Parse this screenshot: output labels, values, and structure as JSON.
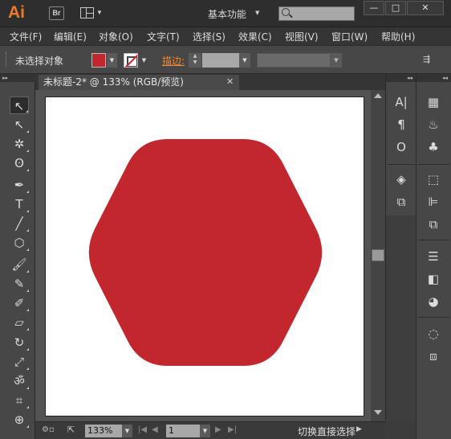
{
  "app": {
    "logo": "Ai",
    "bridge_label": "Br",
    "workspace": "基本功能",
    "search_placeholder": ""
  },
  "window_controls": {
    "minimize": "—",
    "maximize": "□",
    "close": "✕"
  },
  "menu": [
    {
      "label": "文件(F)"
    },
    {
      "label": "编辑(E)"
    },
    {
      "label": "对象(O)"
    },
    {
      "label": "文字(T)"
    },
    {
      "label": "选择(S)"
    },
    {
      "label": "效果(C)"
    },
    {
      "label": "视图(V)"
    },
    {
      "label": "窗口(W)"
    },
    {
      "label": "帮助(H)"
    }
  ],
  "control_bar": {
    "selection_status": "未选择对象",
    "stroke_label": "描边:",
    "fill_color": "#c1272d"
  },
  "document": {
    "tab_title": "未标题-2* @ 133% (RGB/预览)",
    "close": "✕",
    "shape": "rounded-hexagon",
    "shape_color": "#c1272d"
  },
  "status_bar": {
    "zoom": "133%",
    "page": "1",
    "status_text": "切换直接选择"
  },
  "tools": [
    {
      "icon": "selection-tool-icon",
      "glyph": "↖"
    },
    {
      "icon": "direct-selection-tool-icon",
      "glyph": "↖"
    },
    {
      "icon": "magic-wand-tool-icon",
      "glyph": "✲"
    },
    {
      "icon": "lasso-tool-icon",
      "glyph": "ʘ"
    },
    {
      "icon": "pen-tool-icon",
      "glyph": "✒"
    },
    {
      "icon": "type-tool-icon",
      "glyph": "T"
    },
    {
      "icon": "line-tool-icon",
      "glyph": "╱"
    },
    {
      "icon": "polygon-tool-icon",
      "glyph": "⬡"
    },
    {
      "icon": "paintbrush-tool-icon",
      "glyph": "🖌"
    },
    {
      "icon": "pencil-tool-icon",
      "glyph": "✎"
    },
    {
      "icon": "blob-brush-tool-icon",
      "glyph": "✐"
    },
    {
      "icon": "eraser-tool-icon",
      "glyph": "▱"
    },
    {
      "icon": "rotate-tool-icon",
      "glyph": "↻"
    },
    {
      "icon": "scale-tool-icon",
      "glyph": "⤢"
    },
    {
      "icon": "warp-tool-icon",
      "glyph": "ॐ"
    },
    {
      "icon": "free-transform-tool-icon",
      "glyph": "⌗"
    },
    {
      "icon": "shape-builder-tool-icon",
      "glyph": "⊕"
    }
  ],
  "right_panel_1": [
    {
      "icon": "character-panel-icon",
      "glyph": "A|"
    },
    {
      "icon": "paragraph-panel-icon",
      "glyph": "¶"
    },
    {
      "icon": "opentype-panel-icon",
      "glyph": "O"
    },
    {
      "icon": "layers-panel-icon",
      "glyph": "◈"
    },
    {
      "icon": "artboards-panel-icon",
      "glyph": "⧉"
    }
  ],
  "right_panel_2": [
    {
      "icon": "swatches-panel-icon",
      "glyph": "▦"
    },
    {
      "icon": "brushes-panel-icon",
      "glyph": "♨"
    },
    {
      "icon": "symbols-panel-icon",
      "glyph": "♣"
    },
    {
      "icon": "transform-panel-icon",
      "glyph": "⬚"
    },
    {
      "icon": "align-panel-icon",
      "glyph": "⊫"
    },
    {
      "icon": "pathfinder-panel-icon",
      "glyph": "⧉"
    },
    {
      "icon": "stroke-panel-icon",
      "glyph": "☰"
    },
    {
      "icon": "gradient-panel-icon",
      "glyph": "◧"
    },
    {
      "icon": "appearance-panel-icon",
      "glyph": "◕"
    },
    {
      "icon": "graphic-styles-panel-icon",
      "glyph": "◌"
    },
    {
      "icon": "image-trace-panel-icon",
      "glyph": "⧈"
    }
  ]
}
